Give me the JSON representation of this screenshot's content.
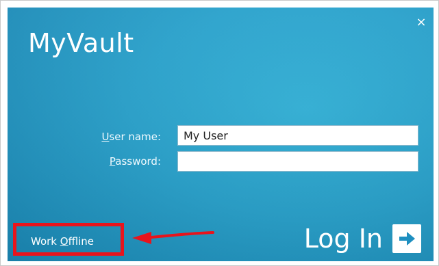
{
  "window": {
    "title": "MyVault",
    "close_glyph": "×",
    "accent_colors": {
      "background": "#2aa2cc",
      "text": "#ffffff"
    }
  },
  "form": {
    "username": {
      "label_underline": "U",
      "label_rest": "ser name:",
      "value": "My User"
    },
    "password": {
      "label_underline": "P",
      "label_rest": "assword:",
      "value": ""
    }
  },
  "work_offline": {
    "label_start": "Work ",
    "label_underline": "O",
    "label_rest": "ffline"
  },
  "login": {
    "label": "Log In",
    "icon": "arrow-right-icon"
  },
  "annotation": {
    "highlight_color": "#e8141c",
    "arrow_icon": "red-arrow-icon"
  }
}
